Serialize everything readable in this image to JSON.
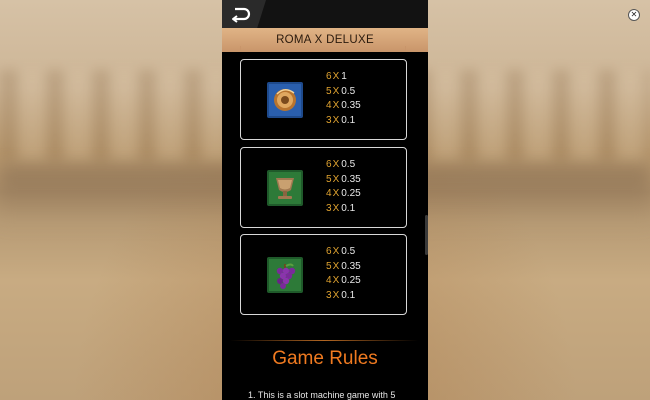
{
  "header": {
    "title": "ROMA X DELUXE"
  },
  "paytable": [
    {
      "symbol": "shield-icon",
      "pays": [
        {
          "count": "6",
          "x": "X",
          "value": "1"
        },
        {
          "count": "5",
          "x": "X",
          "value": "0.5"
        },
        {
          "count": "4",
          "x": "X",
          "value": "0.35"
        },
        {
          "count": "3",
          "x": "X",
          "value": "0.1"
        }
      ]
    },
    {
      "symbol": "chalice-icon",
      "pays": [
        {
          "count": "6",
          "x": "X",
          "value": "0.5"
        },
        {
          "count": "5",
          "x": "X",
          "value": "0.35"
        },
        {
          "count": "4",
          "x": "X",
          "value": "0.25"
        },
        {
          "count": "3",
          "x": "X",
          "value": "0.1"
        }
      ]
    },
    {
      "symbol": "grapes-icon",
      "pays": [
        {
          "count": "6",
          "x": "X",
          "value": "0.5"
        },
        {
          "count": "5",
          "x": "X",
          "value": "0.35"
        },
        {
          "count": "4",
          "x": "X",
          "value": "0.25"
        },
        {
          "count": "3",
          "x": "X",
          "value": "0.1"
        }
      ]
    }
  ],
  "rules": {
    "title": "Game Rules",
    "line1": "1. This is a slot machine game with 5"
  },
  "colors": {
    "accent_orange": "#f07a20",
    "multiplier_gold": "#e0a330",
    "header_copper": "#c9956a"
  }
}
